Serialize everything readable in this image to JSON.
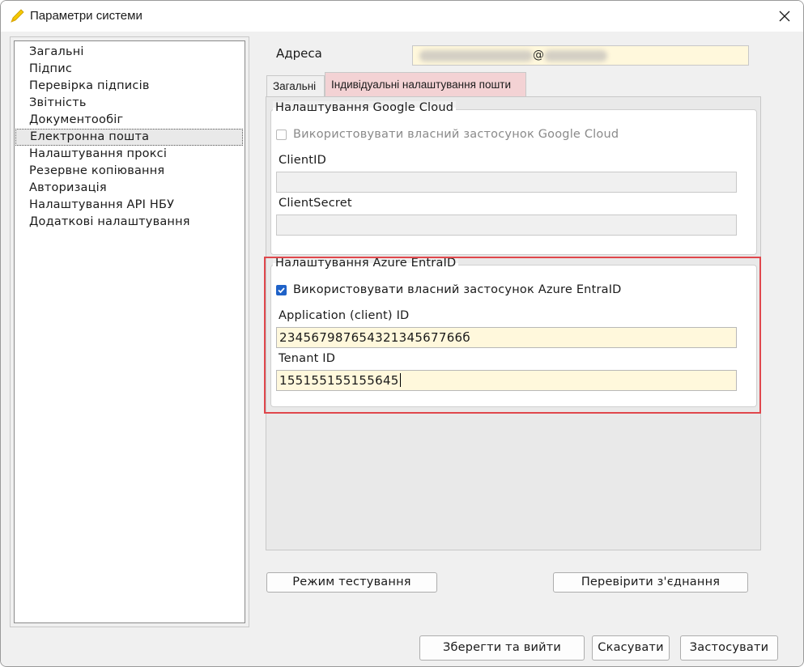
{
  "window": {
    "title": "Параметри системи"
  },
  "nav": {
    "items": [
      {
        "label": "Загальні",
        "selected": false
      },
      {
        "label": "Підпис",
        "selected": false
      },
      {
        "label": "Перевірка підписів",
        "selected": false
      },
      {
        "label": "Звітність",
        "selected": false
      },
      {
        "label": "Документообіг",
        "selected": false
      },
      {
        "label": "Електронна пошта",
        "selected": true
      },
      {
        "label": "Налаштування проксі",
        "selected": false
      },
      {
        "label": "Резервне копіювання",
        "selected": false
      },
      {
        "label": "Авторизація",
        "selected": false
      },
      {
        "label": "Налаштування API НБУ",
        "selected": false
      },
      {
        "label": "Додаткові налаштування",
        "selected": false
      }
    ]
  },
  "address": {
    "label": "Адреса",
    "at": "@"
  },
  "tabs": {
    "general": "Загальні",
    "individual": "Індивідуальні налаштування пошти"
  },
  "google": {
    "legend": "Налаштування Google Cloud",
    "checkbox_label": "Використовувати власний застосунок Google Cloud",
    "checked": false,
    "client_id_label": "ClientID",
    "client_id_value": "",
    "client_secret_label": "ClientSecret",
    "client_secret_value": ""
  },
  "azure": {
    "legend": "Налаштування Azure EntraID",
    "checkbox_label": "Використовувати власний застосунок Azure EntraID",
    "checked": true,
    "app_id_label": "Application (client) ID",
    "app_id_value": "23456798765432134567766б",
    "tenant_id_label": "Tenant ID",
    "tenant_id_value": "155155155155645"
  },
  "buttons": {
    "test_mode": "Режим тестування",
    "check_connection": "Перевірити з'єднання",
    "save_exit": "Зберегти та вийти",
    "cancel": "Скасувати",
    "apply": "Застосувати"
  },
  "colors": {
    "active_input_bg": "#fff8dc",
    "active_tab_bg": "#f3d2d4",
    "highlight_border": "#e0474c",
    "checkbox_checked": "#1f62c8"
  }
}
